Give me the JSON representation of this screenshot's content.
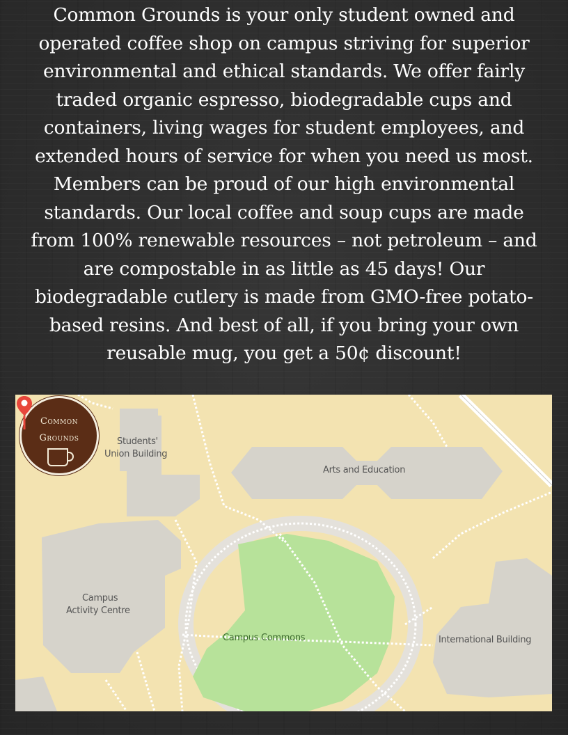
{
  "intro": {
    "lines": [
      "Common Grounds is your only student owned and",
      "operated coffee shop on campus striving for superior",
      "environmental and ethical standards. We offer fairly",
      "traded organic espresso, biodegradable cups and",
      "containers, living wages for student employees, and",
      "extended hours of service for when you need us most.",
      "Members can be proud of our high environmental",
      "standards. Our local coffee and soup cups are made",
      "from 100% renewable resources – not petroleum – and",
      "are compostable in as little as 45 days! Our",
      "biodegradable cutlery is made from GMO-free potato-",
      "based resins. And best of all, if you bring your own",
      "reusable mug, you get a 50¢ discount!"
    ]
  },
  "map": {
    "logo": {
      "line1": "Common",
      "line2": "Grounds"
    },
    "pin_icon": "map-pin-icon",
    "mug_icon": "coffee-mug-icon",
    "labels": {
      "students_union_1": "Students'",
      "students_union_2": "Union Building",
      "arts_education": "Arts and Education",
      "campus_activity_1": "Campus",
      "campus_activity_2": "Activity Centre",
      "campus_commons": "Campus Commons",
      "international": "International Building"
    },
    "colors": {
      "land": "#f3e3b1",
      "building": "#d6d3cb",
      "green": "#b7e29a",
      "path": "#ffffff",
      "pin": "#e8473b",
      "logo_bg": "#5b2d16"
    }
  }
}
